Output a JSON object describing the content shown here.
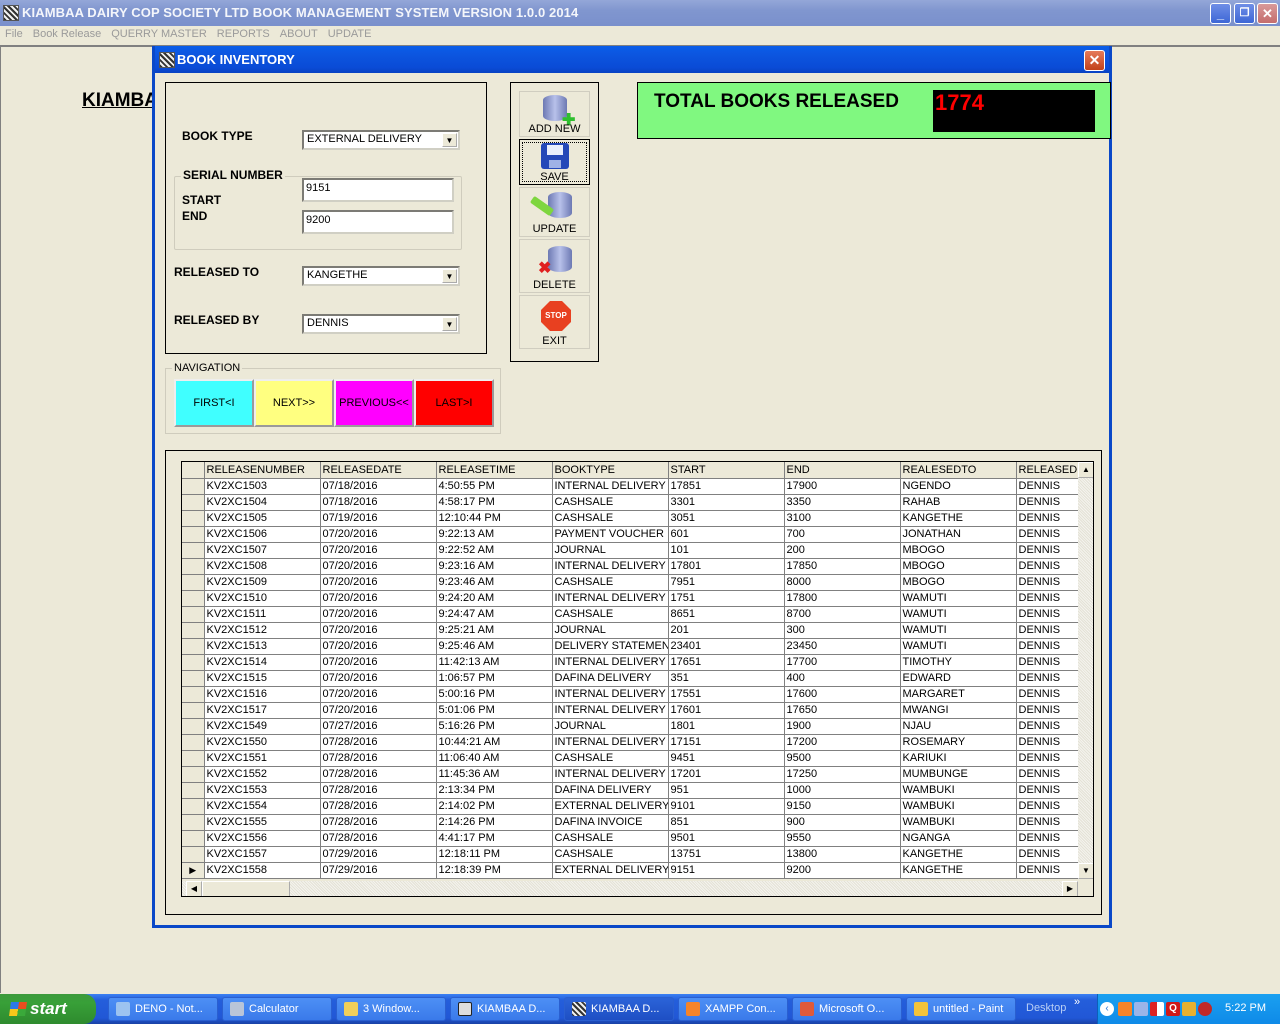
{
  "main_window": {
    "title": "KIAMBAA DAIRY COP SOCIETY LTD BOOK MANAGEMENT SYSTEM VERSION 1.0.0 2014",
    "controls": {
      "minimize": "_",
      "restore": "❐",
      "close": "✕"
    }
  },
  "menu": [
    "File",
    "Book Release",
    "QUERRY MASTER",
    "REPORTS",
    "ABOUT",
    "UPDATE"
  ],
  "background_label": "KIAMBA",
  "dialog": {
    "title": "BOOK INVENTORY",
    "close": "✕",
    "form": {
      "book_type_label": "BOOK TYPE",
      "book_type_value": "EXTERNAL DELIVERY",
      "serial_group_label": "SERIAL NUMBER",
      "start_label": "START",
      "start_value": "9151",
      "end_label": "END",
      "end_value": "9200",
      "released_to_label": "RELEASED TO",
      "released_to_value": "KANGETHE",
      "released_by_label": "RELEASED BY",
      "released_by_value": "DENNIS"
    },
    "navigation": {
      "label": "NAVIGATION",
      "buttons": [
        {
          "label": "FIRST<I",
          "color": "#40ffff"
        },
        {
          "label": "NEXT>>",
          "color": "#ffff80"
        },
        {
          "label": "PREVIOUS<<",
          "color": "#ff00ff"
        },
        {
          "label": "LAST>I",
          "color": "#ff0000"
        }
      ]
    },
    "toolbar": {
      "add_new": "ADD NEW",
      "save": "SAVE",
      "update": "UPDATE",
      "delete": "DELETE",
      "exit": "EXIT",
      "stop_glyph": "STOP"
    },
    "total": {
      "label": "TOTAL BOOKS RELEASED",
      "value": "1774",
      "bg_color": "#80f880",
      "value_color": "#ff0000"
    },
    "grid": {
      "columns": [
        "RELEASENUMBER",
        "RELEASEDATE",
        "RELEASETIME",
        "BOOKTYPE",
        "START",
        "END",
        "REALESEDTO",
        "RELEASEDBY"
      ],
      "rows": [
        [
          "KV2XC1503",
          "07/18/2016",
          "4:50:55 PM",
          "INTERNAL DELIVERY",
          "17851",
          "17900",
          "NGENDO",
          "DENNIS"
        ],
        [
          "KV2XC1504",
          "07/18/2016",
          "4:58:17 PM",
          "CASHSALE",
          "3301",
          "3350",
          "RAHAB",
          "DENNIS"
        ],
        [
          "KV2XC1505",
          "07/19/2016",
          "12:10:44 PM",
          "CASHSALE",
          "3051",
          "3100",
          "KANGETHE",
          "DENNIS"
        ],
        [
          "KV2XC1506",
          "07/20/2016",
          "9:22:13 AM",
          "PAYMENT VOUCHER",
          "601",
          "700",
          "JONATHAN",
          "DENNIS"
        ],
        [
          "KV2XC1507",
          "07/20/2016",
          "9:22:52 AM",
          "JOURNAL",
          "101",
          "200",
          "MBOGO",
          "DENNIS"
        ],
        [
          "KV2XC1508",
          "07/20/2016",
          "9:23:16 AM",
          "INTERNAL DELIVERY",
          "17801",
          "17850",
          "MBOGO",
          "DENNIS"
        ],
        [
          "KV2XC1509",
          "07/20/2016",
          "9:23:46 AM",
          "CASHSALE",
          "7951",
          "8000",
          "MBOGO",
          "DENNIS"
        ],
        [
          "KV2XC1510",
          "07/20/2016",
          "9:24:20 AM",
          "INTERNAL DELIVERY",
          "1751",
          "17800",
          "WAMUTI",
          "DENNIS"
        ],
        [
          "KV2XC1511",
          "07/20/2016",
          "9:24:47 AM",
          "CASHSALE",
          "8651",
          "8700",
          "WAMUTI",
          "DENNIS"
        ],
        [
          "KV2XC1512",
          "07/20/2016",
          "9:25:21 AM",
          "JOURNAL",
          "201",
          "300",
          "WAMUTI",
          "DENNIS"
        ],
        [
          "KV2XC1513",
          "07/20/2016",
          "9:25:46 AM",
          "DELIVERY STATEMENT",
          "23401",
          "23450",
          "WAMUTI",
          "DENNIS"
        ],
        [
          "KV2XC1514",
          "07/20/2016",
          "11:42:13 AM",
          "INTERNAL DELIVERY",
          "17651",
          "17700",
          "TIMOTHY",
          "DENNIS"
        ],
        [
          "KV2XC1515",
          "07/20/2016",
          "1:06:57 PM",
          "DAFINA DELIVERY",
          "351",
          "400",
          "EDWARD",
          "DENNIS"
        ],
        [
          "KV2XC1516",
          "07/20/2016",
          "5:00:16 PM",
          "INTERNAL DELIVERY",
          "17551",
          "17600",
          "MARGARET",
          "DENNIS"
        ],
        [
          "KV2XC1517",
          "07/20/2016",
          "5:01:06 PM",
          "INTERNAL DELIVERY",
          "17601",
          "17650",
          "MWANGI",
          "DENNIS"
        ],
        [
          "KV2XC1549",
          "07/27/2016",
          "5:16:26 PM",
          "JOURNAL",
          "1801",
          "1900",
          "NJAU",
          "DENNIS"
        ],
        [
          "KV2XC1550",
          "07/28/2016",
          "10:44:21 AM",
          "INTERNAL DELIVERY",
          "17151",
          "17200",
          "ROSEMARY",
          "DENNIS"
        ],
        [
          "KV2XC1551",
          "07/28/2016",
          "11:06:40 AM",
          "CASHSALE",
          "9451",
          "9500",
          "KARIUKI",
          "DENNIS"
        ],
        [
          "KV2XC1552",
          "07/28/2016",
          "11:45:36 AM",
          "INTERNAL DELIVERY",
          "17201",
          "17250",
          "MUMBUNGE",
          "DENNIS"
        ],
        [
          "KV2XC1553",
          "07/28/2016",
          "2:13:34 PM",
          "DAFINA DELIVERY",
          "951",
          "1000",
          "WAMBUKI",
          "DENNIS"
        ],
        [
          "KV2XC1554",
          "07/28/2016",
          "2:14:02 PM",
          "EXTERNAL DELIVERY",
          "9101",
          "9150",
          "WAMBUKI",
          "DENNIS"
        ],
        [
          "KV2XC1555",
          "07/28/2016",
          "2:14:26 PM",
          "DAFINA INVOICE",
          "851",
          "900",
          "WAMBUKI",
          "DENNIS"
        ],
        [
          "KV2XC1556",
          "07/28/2016",
          "4:41:17 PM",
          "CASHSALE",
          "9501",
          "9550",
          "NGANGA",
          "DENNIS"
        ],
        [
          "KV2XC1557",
          "07/29/2016",
          "12:18:11 PM",
          "CASHSALE",
          "13751",
          "13800",
          "KANGETHE",
          "DENNIS"
        ],
        [
          "KV2XC1558",
          "07/29/2016",
          "12:18:39 PM",
          "EXTERNAL DELIVERY",
          "9151",
          "9200",
          "KANGETHE",
          "DENNIS"
        ]
      ],
      "current_row_index": 24,
      "current_row_marker": "▶"
    }
  },
  "taskbar": {
    "start_label": "start",
    "items": [
      {
        "label": "DENO - Not...",
        "icon": "notepad-icon"
      },
      {
        "label": "Calculator",
        "icon": "calculator-icon"
      },
      {
        "label": "3 Window...",
        "icon": "folder-icon"
      },
      {
        "label": "KIAMBAA D...",
        "icon": "app-icon"
      },
      {
        "label": "KIAMBAA D...",
        "icon": "app-icon"
      },
      {
        "label": "XAMPP Con...",
        "icon": "xampp-icon"
      },
      {
        "label": "Microsoft O...",
        "icon": "office-icon"
      },
      {
        "label": "untitled - Paint",
        "icon": "paint-icon"
      }
    ],
    "desktop_label": "Desktop",
    "chevron": "»",
    "clock": "5:22 PM"
  }
}
